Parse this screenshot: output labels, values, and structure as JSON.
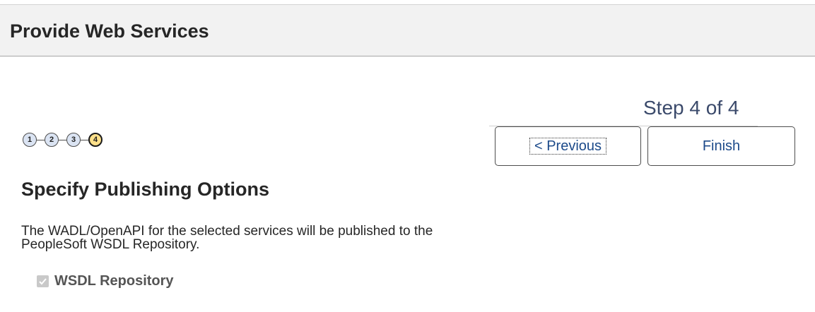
{
  "header": {
    "title": "Provide Web Services"
  },
  "wizard": {
    "step_indicator": "Step 4 of 4",
    "steps": [
      "1",
      "2",
      "3",
      "4"
    ],
    "current_step": 4,
    "previous_label": "< Previous",
    "finish_label": "Finish"
  },
  "section": {
    "title": "Specify Publishing Options",
    "description_line1": "The WADL/OpenAPI for the selected services will be published to the",
    "description_line2": "PeopleSoft WSDL Repository."
  },
  "options": {
    "wsdl_repository_label": "WSDL Repository",
    "wsdl_repository_checked": true,
    "wsdl_repository_disabled": true
  },
  "colors": {
    "header_bg": "#f2f2f2",
    "step_done": "#dbe4f3",
    "step_current": "#fde08a",
    "link_text": "#1c4a8a"
  }
}
